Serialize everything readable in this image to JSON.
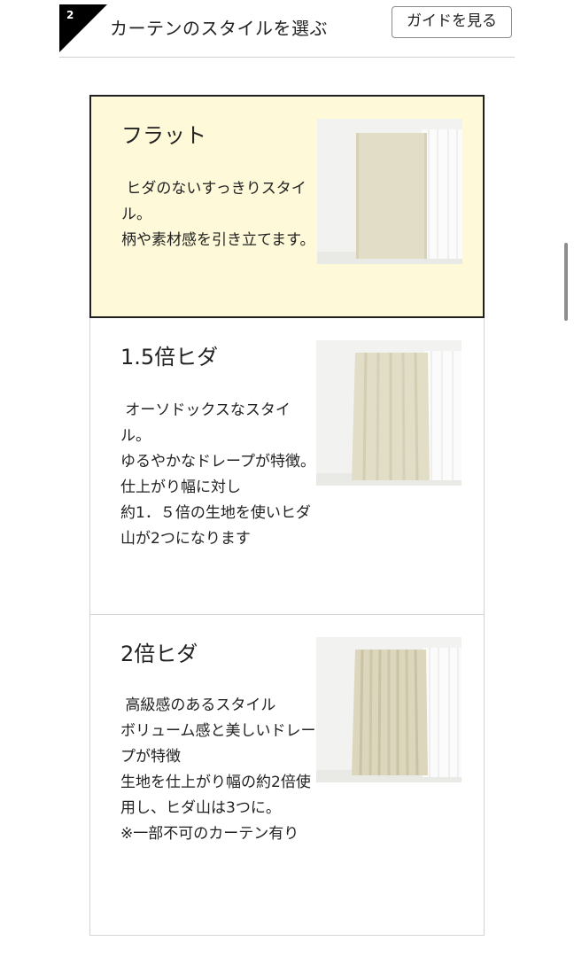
{
  "header": {
    "step_number": "2",
    "title": "カーテンのスタイルを選ぶ",
    "guide_button_label": "ガイドを見る"
  },
  "styles": [
    {
      "title": "フラット",
      "description": " ヒダのないすっきりスタイル。\n柄や素材感を引き立てます。",
      "selected": true,
      "image_icon": "flat-curtain-photo"
    },
    {
      "title": "1.5倍ヒダ",
      "description": " オーソドックスなスタイル。\nゆるやかなドレープが特徴。\n仕上がり幅に対し\n約1．５倍の生地を使いヒダ山が2つになります",
      "selected": false,
      "image_icon": "pleated-1-5x-curtain-photo"
    },
    {
      "title": "2倍ヒダ",
      "description": " 高級感のあるスタイル\nボリューム感と美しいドレープが特徴\n生地を仕上がり幅の約2倍使用し、ヒダ山は3つに。\n※一部不可のカーテン有り",
      "selected": false,
      "image_icon": "pleated-2x-curtain-photo"
    }
  ],
  "colors": {
    "selected_background": "#fdf9d9",
    "selected_border": "#1f1f1f",
    "card_border": "#d4d4d4",
    "curtain_beige": "#e2ddc6",
    "badge": "#000000"
  }
}
